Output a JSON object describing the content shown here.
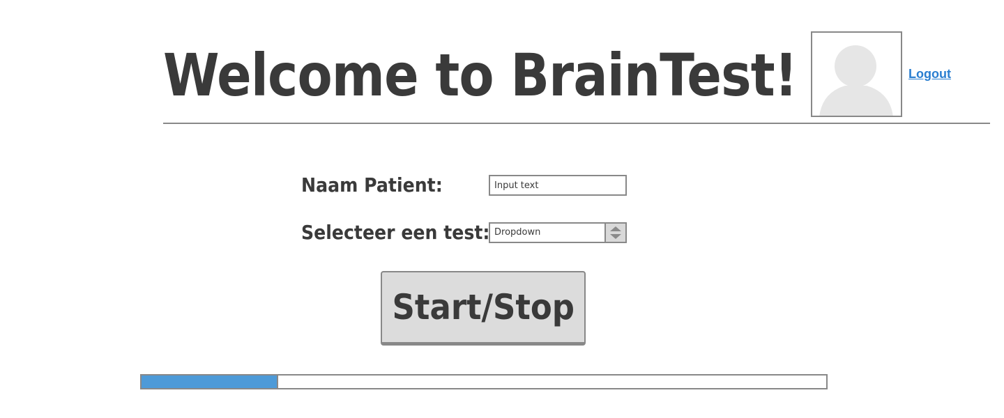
{
  "header": {
    "title": "Welcome to BrainTest!",
    "logout_label": "Logout",
    "avatar_icon": "user-avatar-icon"
  },
  "form": {
    "name_label": "Naam Patient:",
    "name_input_placeholder": "Input text",
    "test_label": "Selecteer een test:",
    "test_dropdown_value": "Dropdown",
    "dropdown_icon": "up-down-arrows-icon"
  },
  "actions": {
    "start_stop_label": "Start/Stop"
  },
  "progress": {
    "value_fraction": 0.2
  },
  "colors": {
    "text": "#3a3a3a",
    "link": "#2a7ed0",
    "progress_fill": "#4d9ad8",
    "border": "#888888",
    "button_bg": "#dcdcdc"
  }
}
